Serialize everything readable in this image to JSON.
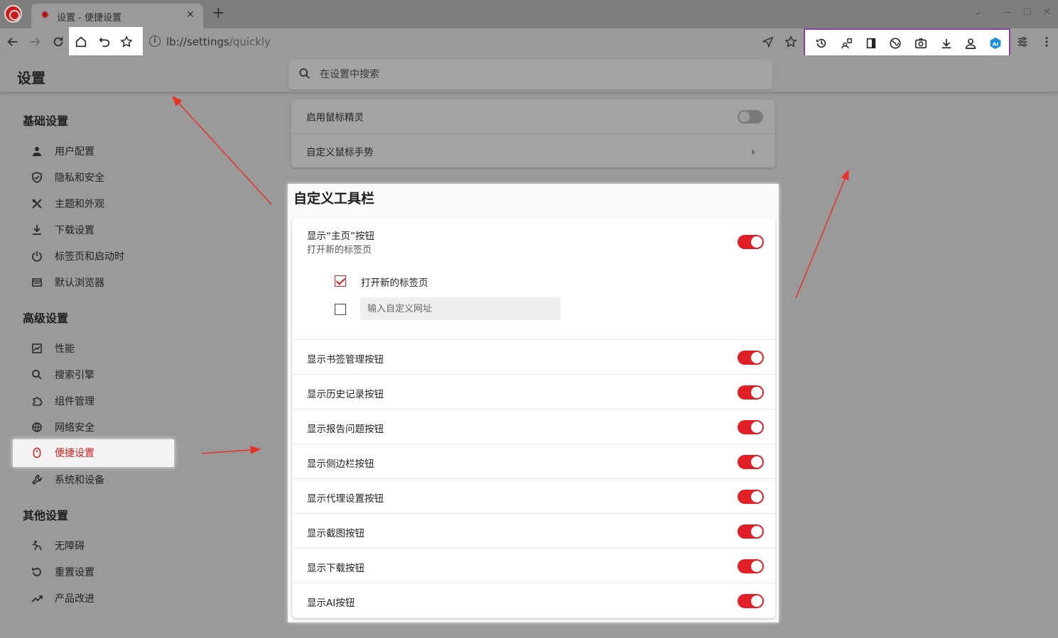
{
  "window": {
    "tab_title": "设置 - 便捷设置",
    "tab_close": "✕",
    "new_tab": "+",
    "controls": [
      "⌄",
      "—",
      "☐",
      "✕"
    ]
  },
  "toolbar": {
    "url_scheme": "lb://",
    "url_host": "settings",
    "url_path": "/quickly",
    "left_buttons": [
      "back-icon",
      "forward-icon",
      "reload-icon"
    ],
    "highlighted_buttons": [
      "home-icon",
      "undo-icon",
      "star-icon"
    ],
    "right_extension_icons": [
      "history-icon",
      "users-icon",
      "sidebar-icon",
      "globe-icon",
      "camera-icon",
      "download-icon",
      "person-icon",
      "ai-icon"
    ],
    "ai_label": "AI"
  },
  "header": {
    "title": "设置",
    "search_placeholder": "在设置中搜索"
  },
  "sidebar": {
    "sections": [
      {
        "title": "基础设置",
        "items": [
          {
            "label": "用户配置",
            "icon": "person-icon"
          },
          {
            "label": "隐私和安全",
            "icon": "shield-icon"
          },
          {
            "label": "主题和外观",
            "icon": "palette-icon"
          },
          {
            "label": "下载设置",
            "icon": "download-icon"
          },
          {
            "label": "标签页和启动时",
            "icon": "power-icon"
          },
          {
            "label": "默认浏览器",
            "icon": "browser-icon"
          }
        ]
      },
      {
        "title": "高级设置",
        "items": [
          {
            "label": "性能",
            "icon": "gauge-icon"
          },
          {
            "label": "搜索引擎",
            "icon": "search-icon"
          },
          {
            "label": "组件管理",
            "icon": "puzzle-icon"
          },
          {
            "label": "网络安全",
            "icon": "globe-icon"
          },
          {
            "label": "便捷设置",
            "icon": "mouse-icon",
            "active": true
          },
          {
            "label": "系统和设备",
            "icon": "wrench-icon"
          }
        ]
      },
      {
        "title": "其他设置",
        "items": [
          {
            "label": "无障碍",
            "icon": "accessibility-icon"
          },
          {
            "label": "重置设置",
            "icon": "reset-icon"
          },
          {
            "label": "产品改进",
            "icon": "trend-icon"
          }
        ]
      }
    ]
  },
  "mouse_card": {
    "rows": [
      {
        "label": "启用鼠标精灵",
        "control": "toggle",
        "on": false
      },
      {
        "label": "自定义鼠标手势",
        "control": "chevron"
      }
    ]
  },
  "toolbar_panel": {
    "title": "自定义工具栏",
    "home_row": {
      "label": "显示“主页”按钮",
      "sub": "打开新的标签页",
      "on": true,
      "option_new_tab": "打开新的标签页",
      "option_new_tab_checked": true,
      "custom_url_placeholder": "输入自定义网址",
      "custom_url_checked": false
    },
    "rows": [
      {
        "label": "显示书签管理按钮",
        "on": true
      },
      {
        "label": "显示历史记录按钮",
        "on": true
      },
      {
        "label": "显示报告问题按钮",
        "on": true
      },
      {
        "label": "显示侧边栏按钮",
        "on": true
      },
      {
        "label": "显示代理设置按钮",
        "on": true
      },
      {
        "label": "显示截图按钮",
        "on": true
      },
      {
        "label": "显示下载按钮",
        "on": true
      },
      {
        "label": "显示AI按钮",
        "on": true
      }
    ]
  },
  "colors": {
    "accent": "#e01f26",
    "overlay_gray": "#9a9a9a",
    "purple_frame": "#8a3fa0"
  }
}
